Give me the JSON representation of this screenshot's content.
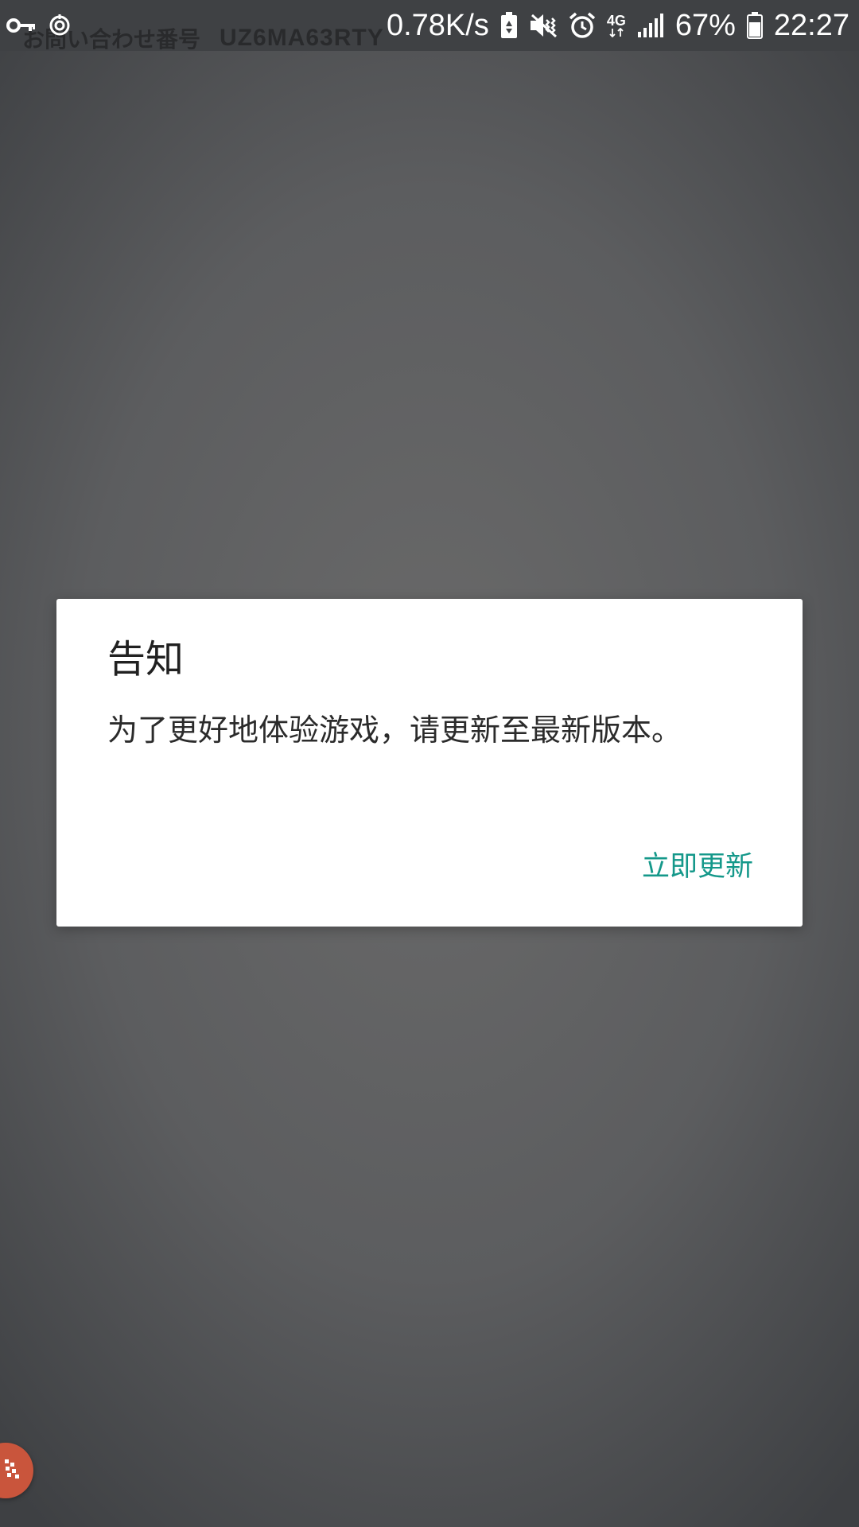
{
  "status_bar": {
    "overlay_label": "お問い合わせ番号",
    "overlay_code": "UZ6MA63RTY",
    "network_speed": "0.78K/s",
    "network_type": "4G",
    "battery_percent": "67%",
    "time": "22:27",
    "icons": [
      "key-icon",
      "sync-icon",
      "battery-saver-icon",
      "vibrate-mute-icon",
      "alarm-icon",
      "signal-icon",
      "battery-icon"
    ]
  },
  "dialog": {
    "title": "告知",
    "message": "为了更好地体验游戏，请更新至最新版本。",
    "action_label": "立即更新",
    "accent_color": "#14988a"
  },
  "floating_bubble": {
    "icon": "game-assistant-icon",
    "color": "#c9553c"
  }
}
